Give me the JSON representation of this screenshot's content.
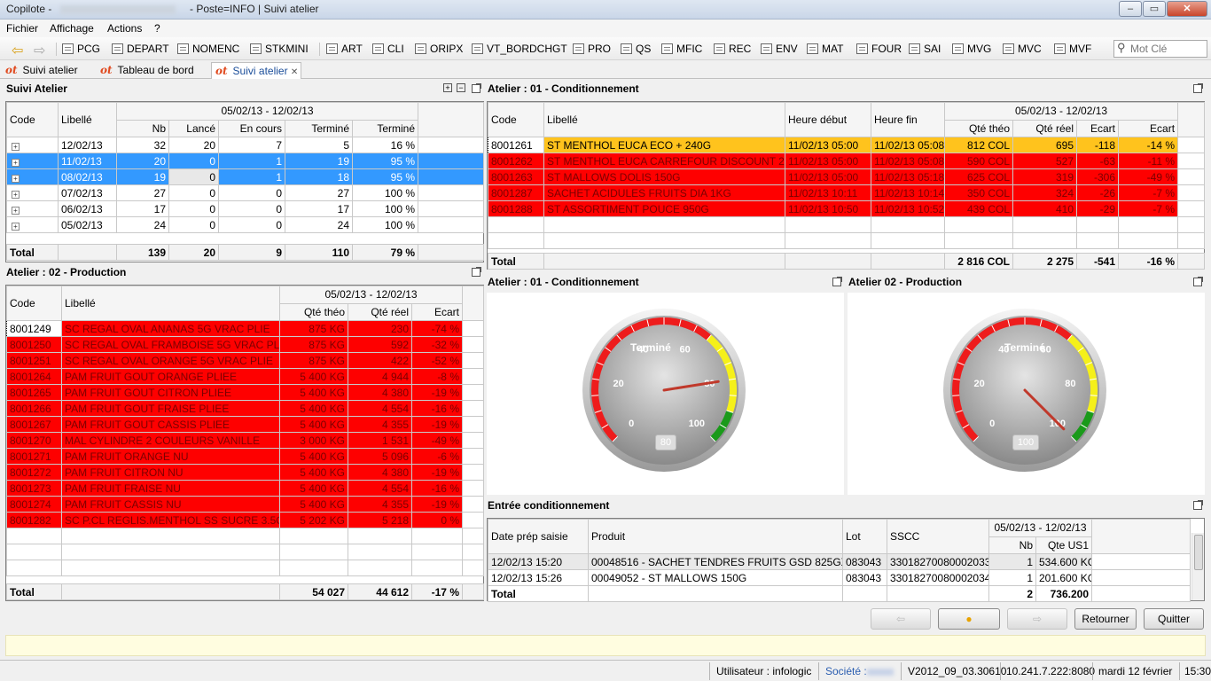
{
  "window": {
    "title": "Copilote -",
    "title_suffix": "- Poste=INFO | Suivi atelier",
    "min": "–",
    "max": "▭",
    "close": "✕"
  },
  "menu": [
    "Fichier",
    "Affichage",
    "Actions",
    "?"
  ],
  "toolbar": [
    "PCG",
    "DEPART",
    "NOMENC",
    "STKMINI",
    "ART",
    "CLI",
    "ORIPX",
    "VT_BORDCHGT",
    "PRO",
    "QS",
    "MFIC",
    "REC",
    "ENV",
    "MAT",
    "FOUR",
    "SAI",
    "MVG",
    "MVC",
    "MVF"
  ],
  "search": {
    "placeholder": "Mot Clé"
  },
  "tabs": [
    {
      "label": "Suivi atelier",
      "prefix": "ot"
    },
    {
      "label": "Tableau de bord",
      "prefix": "ot"
    },
    {
      "label": "Suivi atelier",
      "prefix": "ot",
      "close": "✕"
    }
  ],
  "suivi": {
    "title": "Suivi Atelier",
    "headers": {
      "code": "Code",
      "libelle": "Libellé",
      "period": "05/02/13 - 12/02/13",
      "nb": "Nb",
      "lance": "Lancé",
      "encours": "En cours",
      "termine": "Terminé",
      "termine_pct": "Terminé"
    },
    "rows": [
      {
        "exp": "+",
        "libelle": "12/02/13",
        "nb": "32",
        "lance": "20",
        "encours": "7",
        "termine": "5",
        "pct": "16 %"
      },
      {
        "exp": "+",
        "libelle": "11/02/13",
        "nb": "20",
        "lance": "0",
        "encours": "1",
        "termine": "19",
        "pct": "95 %"
      },
      {
        "exp": "+",
        "libelle": "08/02/13",
        "nb": "19",
        "lance": "0",
        "encours": "1",
        "termine": "18",
        "pct": "95 %"
      },
      {
        "exp": "+",
        "libelle": "07/02/13",
        "nb": "27",
        "lance": "0",
        "encours": "0",
        "termine": "27",
        "pct": "100 %"
      },
      {
        "exp": "+",
        "libelle": "06/02/13",
        "nb": "17",
        "lance": "0",
        "encours": "0",
        "termine": "17",
        "pct": "100 %"
      },
      {
        "exp": "+",
        "libelle": "05/02/13",
        "nb": "24",
        "lance": "0",
        "encours": "0",
        "termine": "24",
        "pct": "100 %"
      }
    ],
    "total": {
      "label": "Total",
      "nb": "139",
      "lance": "20",
      "encours": "9",
      "termine": "110",
      "pct": "79 %"
    }
  },
  "prod": {
    "title": "Atelier : 02 - Production",
    "headers": {
      "code": "Code",
      "libelle": "Libellé",
      "period": "05/02/13 - 12/02/13",
      "qte_theo": "Qté théo",
      "qte_reel": "Qté réel",
      "ecart": "Ecart"
    },
    "rows": [
      [
        "8001249",
        "SC REGAL OVAL ANANAS 5G VRAC PLIE",
        "875 KG",
        "230",
        "-74 %"
      ],
      [
        "8001250",
        "SC REGAL OVAL FRAMBOISE 5G VRAC PLIE",
        "875 KG",
        "592",
        "-32 %"
      ],
      [
        "8001251",
        "SC REGAL OVAL ORANGE 5G VRAC PLIE",
        "875 KG",
        "422",
        "-52 %"
      ],
      [
        "8001264",
        "PAM FRUIT GOUT ORANGE PLIEE",
        "5 400 KG",
        "4 944",
        "-8 %"
      ],
      [
        "8001265",
        "PAM FRUIT GOUT CITRON PLIEE",
        "5 400 KG",
        "4 380",
        "-19 %"
      ],
      [
        "8001266",
        "PAM FRUIT GOUT FRAISE PLIEE",
        "5 400 KG",
        "4 554",
        "-16 %"
      ],
      [
        "8001267",
        "PAM FRUIT GOUT CASSIS PLIEE",
        "5 400 KG",
        "4 355",
        "-19 %"
      ],
      [
        "8001270",
        "MAL CYLINDRE 2 COULEURS VANILLE",
        "3 000 KG",
        "1 531",
        "-49 %"
      ],
      [
        "8001271",
        "PAM FRUIT ORANGE NU",
        "5 400 KG",
        "5 096",
        "-6 %"
      ],
      [
        "8001272",
        "PAM FRUIT CITRON NU",
        "5 400 KG",
        "4 380",
        "-19 %"
      ],
      [
        "8001273",
        "PAM FRUIT FRAISE NU",
        "5 400 KG",
        "4 554",
        "-16 %"
      ],
      [
        "8001274",
        "PAM FRUIT CASSIS NU",
        "5 400 KG",
        "4 355",
        "-19 %"
      ],
      [
        "8001282",
        "SC P.CL REGLIS.MENTHOL SS SUCRE 3.5G NU",
        "5 202 KG",
        "5 218",
        "0 %"
      ]
    ],
    "total": {
      "label": "Total",
      "qte_theo": "54 027",
      "qte_reel": "44 612",
      "ecart": "-17 %"
    }
  },
  "cond": {
    "title": "Atelier : 01 - Conditionnement",
    "headers": {
      "code": "Code",
      "libelle": "Libellé",
      "debut": "Heure début",
      "fin": "Heure fin",
      "period": "05/02/13 - 12/02/13",
      "qte_theo": "Qté théo",
      "qte_reel": "Qté réel",
      "ecart": "Ecart",
      "ecart_pct": "Ecart"
    },
    "rows": [
      [
        "8001261",
        "ST MENTHOL EUCA ECO + 240G",
        "11/02/13 05:00",
        "11/02/13 05:08",
        "812 COL",
        "695",
        "-118",
        "-14 %"
      ],
      [
        "8001262",
        "ST MENTHOL EUCA CARREFOUR DISCOUNT 240G",
        "11/02/13 05:00",
        "11/02/13 05:08",
        "590 COL",
        "527",
        "-63",
        "-11 %"
      ],
      [
        "8001263",
        "ST MALLOWS DOLIS 150G",
        "11/02/13 05:00",
        "11/02/13 05:18",
        "625 COL",
        "319",
        "-306",
        "-49 %"
      ],
      [
        "8001287",
        "SACHET ACIDULES FRUITS DIA 1KG",
        "11/02/13 10:11",
        "11/02/13 10:14",
        "350 COL",
        "324",
        "-26",
        "-7 %"
      ],
      [
        "8001288",
        "ST ASSORTIMENT POUCE 950G",
        "11/02/13 10:50",
        "11/02/13 10:52",
        "439 COL",
        "410",
        "-29",
        "-7 %"
      ]
    ],
    "total": {
      "label": "Total",
      "qte_theo": "2 816 COL",
      "qte_reel": "2 275",
      "ecart": "-541",
      "ecart_pct": "-16 %"
    }
  },
  "gauges": [
    {
      "title": "Atelier : 01 - Conditionnement",
      "label": "Terminé",
      "value": 80,
      "readout": "80",
      "ticks": [
        "0",
        "20",
        "40",
        "60",
        "80",
        "100"
      ]
    },
    {
      "title": "Atelier 02 - Production",
      "label": "Terminé",
      "value": 100,
      "readout": "100",
      "ticks": [
        "0",
        "20",
        "40",
        "60",
        "80",
        "100"
      ]
    }
  ],
  "entree": {
    "title": "Entrée conditionnement",
    "headers": {
      "date": "Date prép saisie",
      "produit": "Produit",
      "lot": "Lot",
      "sscc": "SSCC",
      "period": "05/02/13 - 12/02/13",
      "nb": "Nb",
      "qte": "Qte US1"
    },
    "rows": [
      [
        "12/02/13 15:20",
        "00048516 - SACHET TENDRES FRUITS GSD 825GX12ST",
        "083043",
        "330182700800020338",
        "1",
        "534.600 KG"
      ],
      [
        "12/02/13 15:26",
        "00049052 - ST MALLOWS 150G",
        "083043",
        "330182700800020345",
        "1",
        "201.600 KG"
      ]
    ],
    "total": {
      "label": "Total",
      "nb": "2",
      "qte": "736.200"
    }
  },
  "buttons": {
    "prev": "⇦",
    "center": "●",
    "next": "⇨",
    "retour": "Retourner",
    "quit": "Quitter"
  },
  "status": {
    "user": "Utilisateur : infologic",
    "societe": "Société :",
    "version": "V2012_09_03.30610",
    "server": "10.241.7.222:8080",
    "date": "mardi 12 février",
    "time": "15:30"
  }
}
